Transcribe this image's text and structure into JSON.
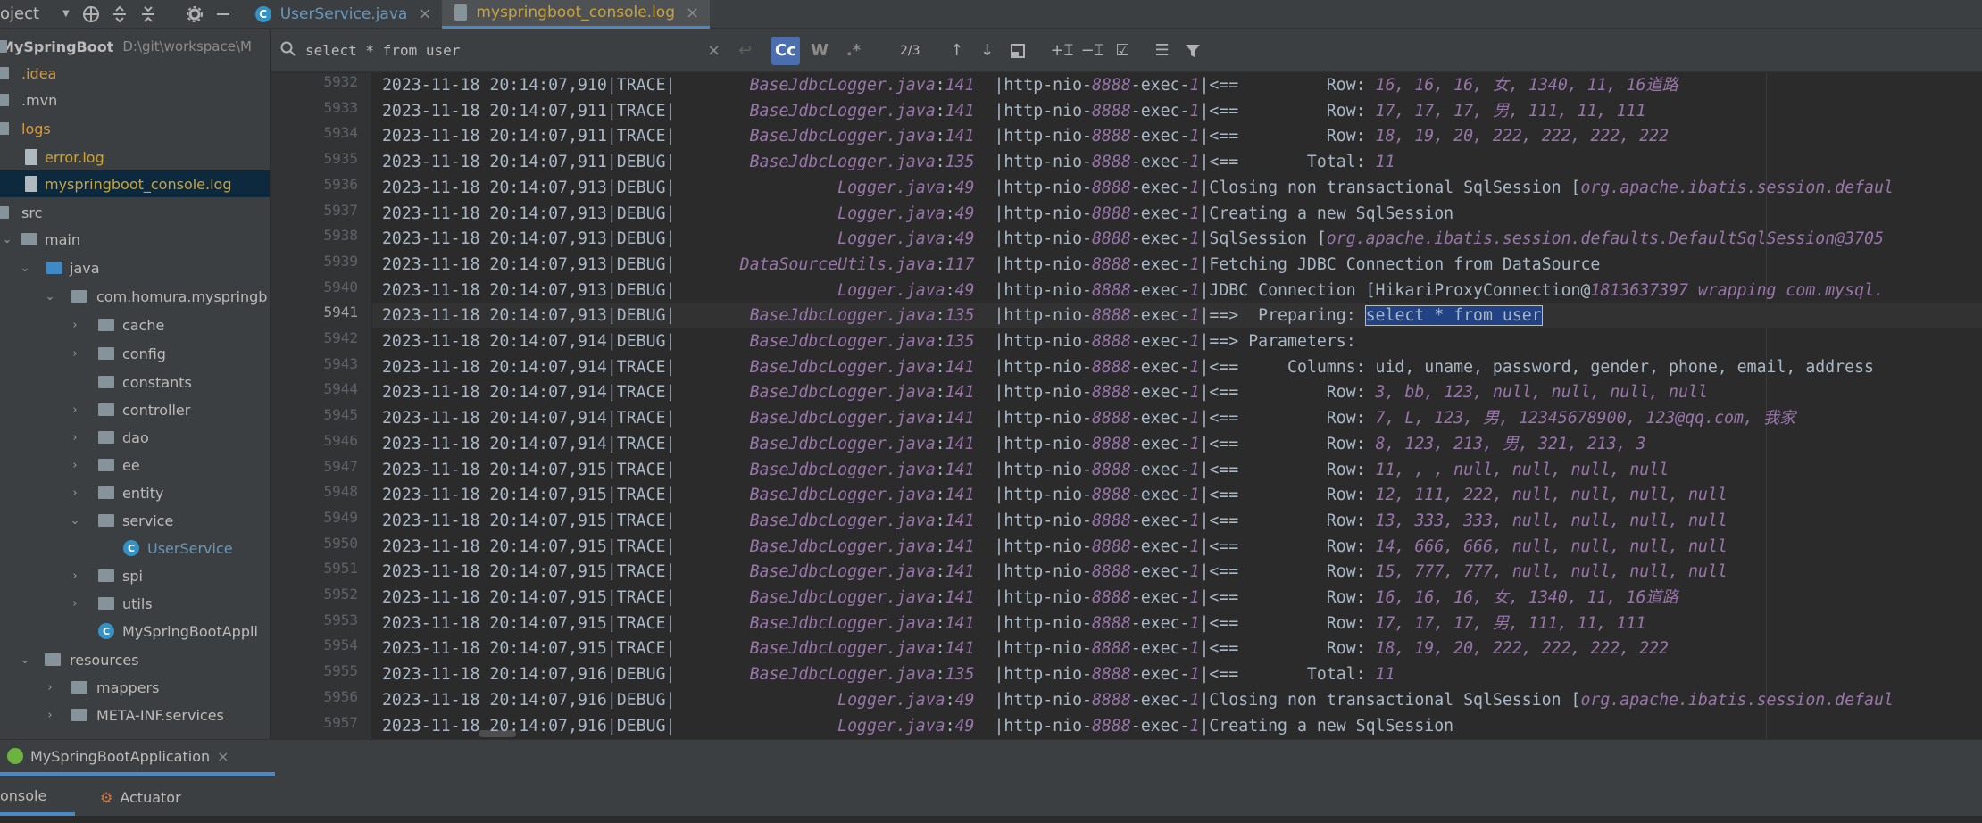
{
  "topbar": {
    "project_label": "oject",
    "tabs": [
      {
        "label": "UserService.java",
        "close": "×"
      },
      {
        "label": "myspringboot_console.log",
        "close": "×"
      }
    ]
  },
  "sidebar": {
    "root": {
      "name": "MySpringBoot",
      "path": "D:\\git\\workspace\\M"
    },
    "items": [
      {
        "label": ".idea"
      },
      {
        "label": ".mvn"
      },
      {
        "label": "logs"
      },
      {
        "label": "error.log"
      },
      {
        "label": "myspringboot_console.log"
      },
      {
        "label": "src"
      },
      {
        "label": "main"
      },
      {
        "label": "java"
      },
      {
        "label": "com.homura.myspringb"
      },
      {
        "label": "cache"
      },
      {
        "label": "config"
      },
      {
        "label": "constants"
      },
      {
        "label": "controller"
      },
      {
        "label": "dao"
      },
      {
        "label": "ee"
      },
      {
        "label": "entity"
      },
      {
        "label": "service"
      },
      {
        "label": "UserService"
      },
      {
        "label": "spi"
      },
      {
        "label": "utils"
      },
      {
        "label": "MySpringBootAppli"
      },
      {
        "label": "resources"
      },
      {
        "label": "mappers"
      },
      {
        "label": "META-INF.services"
      }
    ]
  },
  "search": {
    "value": "select * from user",
    "match_count": "2/3",
    "case_label": "Cc",
    "word_label": "W",
    "regex_label": ".*"
  },
  "log": {
    "line_numbers": [
      "5932",
      "5933",
      "5934",
      "5935",
      "5936",
      "5937",
      "5938",
      "5939",
      "5940",
      "5941",
      "5942",
      "5943",
      "5944",
      "5945",
      "5946",
      "5947",
      "5948",
      "5949",
      "5950",
      "5951",
      "5952",
      "5953",
      "5954",
      "5955",
      "5956",
      "5957"
    ],
    "lines": [
      {
        "ts": "2023-11-18 20:14:07,910",
        "lvl": "TRACE",
        "src": "BaseJdbcLogger.java",
        "ln": "141",
        "thr": "8888",
        "msg": "<==         Row: ",
        "it": "16, 16, 16, 女, 1340, 11, 16道路"
      },
      {
        "ts": "2023-11-18 20:14:07,911",
        "lvl": "TRACE",
        "src": "BaseJdbcLogger.java",
        "ln": "141",
        "thr": "8888",
        "msg": "<==         Row: ",
        "it": "17, 17, 17, 男, 111, 11, 111"
      },
      {
        "ts": "2023-11-18 20:14:07,911",
        "lvl": "TRACE",
        "src": "BaseJdbcLogger.java",
        "ln": "141",
        "thr": "8888",
        "msg": "<==         Row: ",
        "it": "18, 19, 20, 222, 222, 222, 222"
      },
      {
        "ts": "2023-11-18 20:14:07,911",
        "lvl": "DEBUG",
        "src": "BaseJdbcLogger.java",
        "ln": "135",
        "thr": "8888",
        "msg": "<==       Total: ",
        "it": "11"
      },
      {
        "ts": "2023-11-18 20:14:07,913",
        "lvl": "DEBUG",
        "src": "Logger.java",
        "ln": "49",
        "thr": "8888",
        "msg": "Closing non transactional SqlSession [",
        "it": "org.apache.ibatis.session.defaul"
      },
      {
        "ts": "2023-11-18 20:14:07,913",
        "lvl": "DEBUG",
        "src": "Logger.java",
        "ln": "49",
        "thr": "8888",
        "msg": "Creating a new SqlSession",
        "it": ""
      },
      {
        "ts": "2023-11-18 20:14:07,913",
        "lvl": "DEBUG",
        "src": "Logger.java",
        "ln": "49",
        "thr": "8888",
        "msg": "SqlSession [",
        "it": "org.apache.ibatis.session.defaults.DefaultSqlSession@3705"
      },
      {
        "ts": "2023-11-18 20:14:07,913",
        "lvl": "DEBUG",
        "src": "DataSourceUtils.java",
        "ln": "117",
        "thr": "8888",
        "msg": "Fetching JDBC Connection from DataSource",
        "it": ""
      },
      {
        "ts": "2023-11-18 20:14:07,913",
        "lvl": "DEBUG",
        "src": "Logger.java",
        "ln": "49",
        "thr": "8888",
        "msg": "JDBC Connection [HikariProxyConnection@",
        "it": "1813637397 wrapping com.mysql."
      },
      {
        "ts": "2023-11-18 20:14:07,913",
        "lvl": "DEBUG",
        "src": "BaseJdbcLogger.java",
        "ln": "135",
        "thr": "8888",
        "msg": "==>  Preparing: ",
        "hl": "select * from user"
      },
      {
        "ts": "2023-11-18 20:14:07,914",
        "lvl": "DEBUG",
        "src": "BaseJdbcLogger.java",
        "ln": "135",
        "thr": "8888",
        "msg": "==> Parameters: ",
        "it": ""
      },
      {
        "ts": "2023-11-18 20:14:07,914",
        "lvl": "TRACE",
        "src": "BaseJdbcLogger.java",
        "ln": "141",
        "thr": "8888",
        "msg": "<==     Columns: uid, uname, password, gender, phone, email, address",
        "it": ""
      },
      {
        "ts": "2023-11-18 20:14:07,914",
        "lvl": "TRACE",
        "src": "BaseJdbcLogger.java",
        "ln": "141",
        "thr": "8888",
        "msg": "<==         Row: ",
        "it": "3, bb, 123, null, null, null, null"
      },
      {
        "ts": "2023-11-18 20:14:07,914",
        "lvl": "TRACE",
        "src": "BaseJdbcLogger.java",
        "ln": "141",
        "thr": "8888",
        "msg": "<==         Row: ",
        "it": "7, L, 123, 男, 12345678900, 123@qq.com, 我家"
      },
      {
        "ts": "2023-11-18 20:14:07,914",
        "lvl": "TRACE",
        "src": "BaseJdbcLogger.java",
        "ln": "141",
        "thr": "8888",
        "msg": "<==         Row: ",
        "it": "8, 123, 213, 男, 321, 213, 3"
      },
      {
        "ts": "2023-11-18 20:14:07,915",
        "lvl": "TRACE",
        "src": "BaseJdbcLogger.java",
        "ln": "141",
        "thr": "8888",
        "msg": "<==         Row: ",
        "it": "11, , , null, null, null, null"
      },
      {
        "ts": "2023-11-18 20:14:07,915",
        "lvl": "TRACE",
        "src": "BaseJdbcLogger.java",
        "ln": "141",
        "thr": "8888",
        "msg": "<==         Row: ",
        "it": "12, 111, 222, null, null, null, null"
      },
      {
        "ts": "2023-11-18 20:14:07,915",
        "lvl": "TRACE",
        "src": "BaseJdbcLogger.java",
        "ln": "141",
        "thr": "8888",
        "msg": "<==         Row: ",
        "it": "13, 333, 333, null, null, null, null"
      },
      {
        "ts": "2023-11-18 20:14:07,915",
        "lvl": "TRACE",
        "src": "BaseJdbcLogger.java",
        "ln": "141",
        "thr": "8888",
        "msg": "<==         Row: ",
        "it": "14, 666, 666, null, null, null, null"
      },
      {
        "ts": "2023-11-18 20:14:07,915",
        "lvl": "TRACE",
        "src": "BaseJdbcLogger.java",
        "ln": "141",
        "thr": "8888",
        "msg": "<==         Row: ",
        "it": "15, 777, 777, null, null, null, null"
      },
      {
        "ts": "2023-11-18 20:14:07,915",
        "lvl": "TRACE",
        "src": "BaseJdbcLogger.java",
        "ln": "141",
        "thr": "8888",
        "msg": "<==         Row: ",
        "it": "16, 16, 16, 女, 1340, 11, 16道路"
      },
      {
        "ts": "2023-11-18 20:14:07,915",
        "lvl": "TRACE",
        "src": "BaseJdbcLogger.java",
        "ln": "141",
        "thr": "8888",
        "msg": "<==         Row: ",
        "it": "17, 17, 17, 男, 111, 11, 111"
      },
      {
        "ts": "2023-11-18 20:14:07,915",
        "lvl": "TRACE",
        "src": "BaseJdbcLogger.java",
        "ln": "141",
        "thr": "8888",
        "msg": "<==         Row: ",
        "it": "18, 19, 20, 222, 222, 222, 222"
      },
      {
        "ts": "2023-11-18 20:14:07,916",
        "lvl": "DEBUG",
        "src": "BaseJdbcLogger.java",
        "ln": "135",
        "thr": "8888",
        "msg": "<==       Total: ",
        "it": "11"
      },
      {
        "ts": "2023-11-18 20:14:07,916",
        "lvl": "DEBUG",
        "src": "Logger.java",
        "ln": "49",
        "thr": "8888",
        "msg": "Closing non transactional SqlSession [",
        "it": "org.apache.ibatis.session.defaul"
      },
      {
        "ts": "2023-11-18 20:14:07,916",
        "lvl": "DEBUG",
        "src": "Logger.java",
        "ln": "49",
        "thr": "8888",
        "msg": "Creating a new SqlSession",
        "it": ""
      }
    ]
  },
  "run": {
    "app_label": "MySpringBootApplication",
    "close": "×",
    "tabs": [
      {
        "label": "onsole"
      },
      {
        "label": "Actuator"
      }
    ]
  },
  "colors": {
    "accent": "#4a88c7",
    "selection": "#214283",
    "italic_purple": "#9876aa"
  }
}
